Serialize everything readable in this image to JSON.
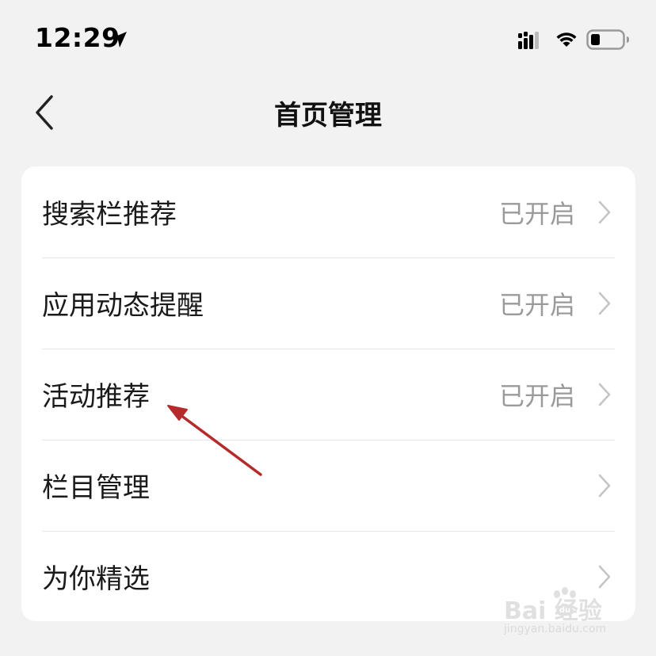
{
  "status_bar": {
    "time": "12:29",
    "icons": [
      "location-arrow-icon",
      "cellular-signal-icon",
      "wifi-icon",
      "battery-icon"
    ]
  },
  "nav": {
    "back_icon": "chevron-left-icon",
    "title": "首页管理"
  },
  "settings": {
    "items": [
      {
        "label": "搜索栏推荐",
        "status": "已开启"
      },
      {
        "label": "应用动态提醒",
        "status": "已开启"
      },
      {
        "label": "活动推荐",
        "status": "已开启"
      },
      {
        "label": "栏目管理",
        "status": ""
      },
      {
        "label": "为你精选",
        "status": ""
      }
    ]
  },
  "annotation": {
    "type": "arrow",
    "color": "#b52a2a",
    "points_to": "活动推荐"
  },
  "watermark": {
    "main": "Bai  经验",
    "paw_text": "du",
    "sub": "jingyan.baidu.com"
  },
  "colors": {
    "background": "#f2f2f2",
    "card": "#ffffff",
    "status_text": "#9a9a9a",
    "annotation_arrow": "#b52a2a"
  }
}
